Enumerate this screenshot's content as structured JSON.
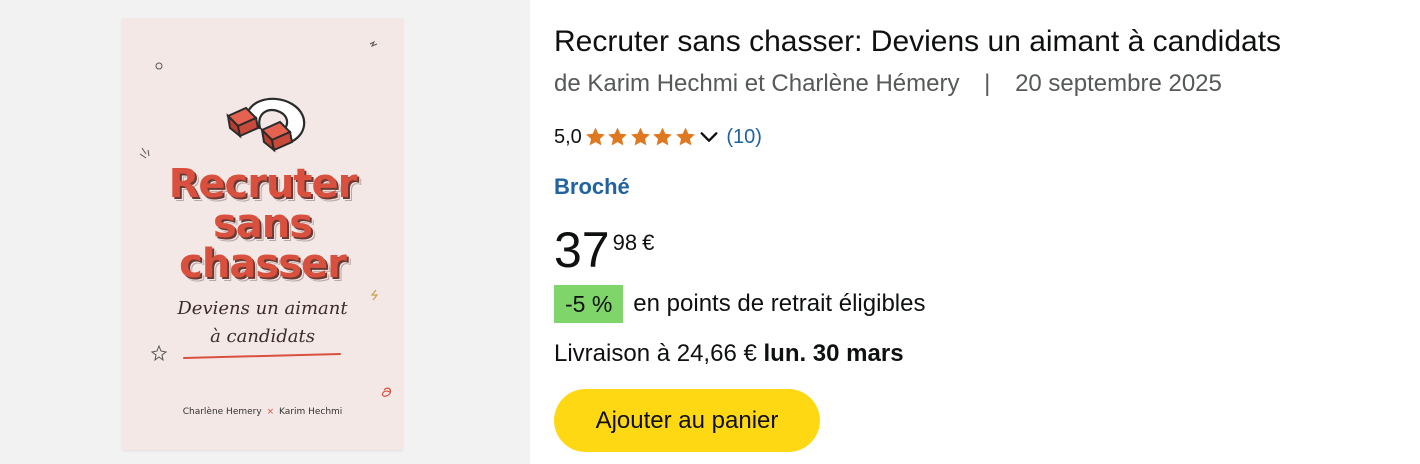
{
  "cover": {
    "title_lines": [
      "Recruter",
      "sans",
      "chasser"
    ],
    "subtitle_lines": [
      "Deviens un aimant",
      "à candidats"
    ],
    "author_1": "Charlène Hemery",
    "author_sep": "×",
    "author_2": "Karim Hechmi"
  },
  "product": {
    "title": "Recruter sans chasser: Deviens un aimant à candidats",
    "byline_authors": "de Karim Hechmi et Charlène Hémery",
    "byline_separator": "|",
    "publication_date": "20 septembre 2025",
    "rating_value": "5,0",
    "rating_stars": 5,
    "rating_max": 5,
    "review_count": "(10)",
    "format": "Broché",
    "price_whole": "37",
    "price_fraction": "98",
    "price_currency": "€",
    "promo_badge": "-5 %",
    "promo_text": "en points de retrait éligibles",
    "delivery_prefix": "Livraison à 24,66 €",
    "delivery_date": "lun. 30 mars",
    "add_to_cart_label": "Ajouter au panier"
  },
  "colors": {
    "star": "#de7921",
    "link": "#2162a1",
    "promo_badge_bg": "#7fd46a",
    "button_bg": "#ffd814",
    "cover_accent": "#d9513e",
    "cover_bg": "#f3e8e6"
  },
  "icons": [
    "magnet-icon",
    "star-icon",
    "chevron-down-icon"
  ]
}
